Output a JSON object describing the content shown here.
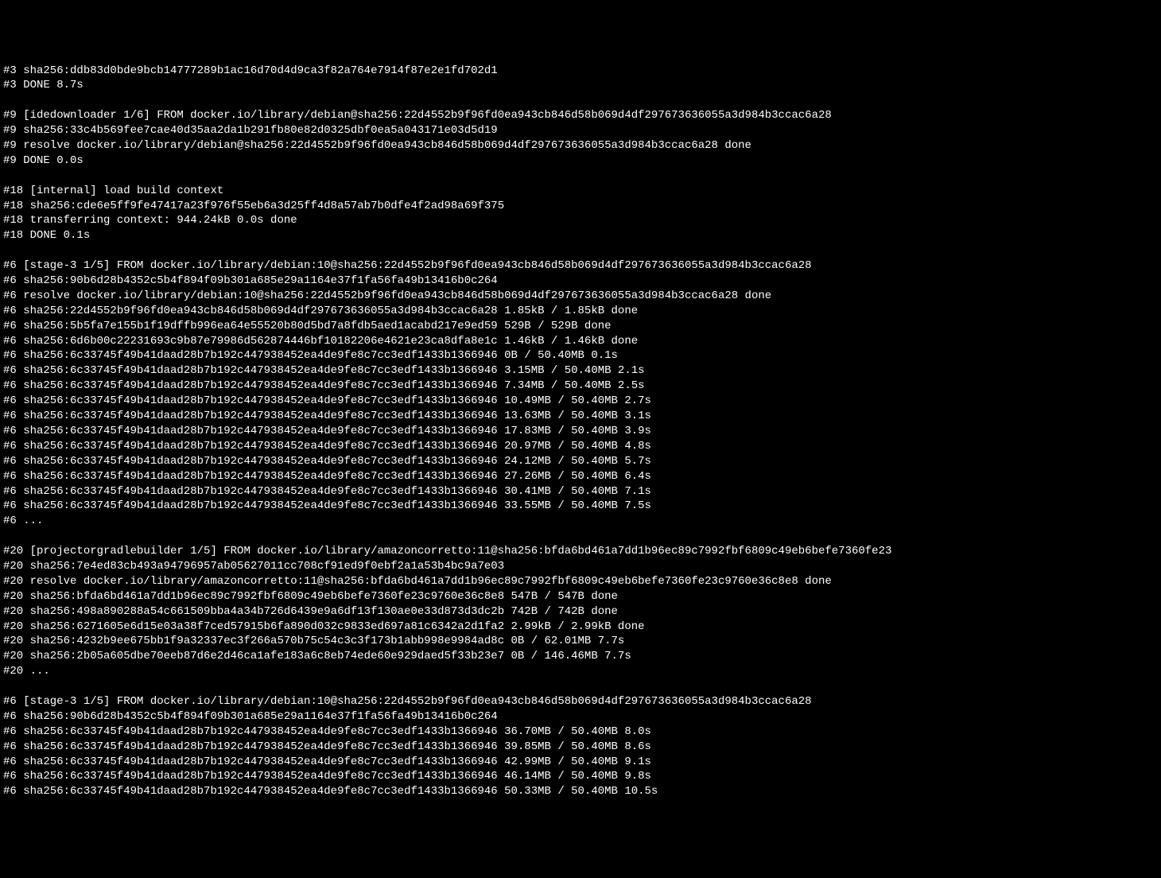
{
  "lines": [
    "#3 sha256:ddb83d0bde9bcb14777289b1ac16d70d4d9ca3f82a764e7914f87e2e1fd702d1",
    "#3 DONE 8.7s",
    "",
    "#9 [idedownloader 1/6] FROM docker.io/library/debian@sha256:22d4552b9f96fd0ea943cb846d58b069d4df297673636055a3d984b3ccac6a28",
    "#9 sha256:33c4b569fee7cae40d35aa2da1b291fb80e82d0325dbf0ea5a043171e03d5d19",
    "#9 resolve docker.io/library/debian@sha256:22d4552b9f96fd0ea943cb846d58b069d4df297673636055a3d984b3ccac6a28 done",
    "#9 DONE 0.0s",
    "",
    "#18 [internal] load build context",
    "#18 sha256:cde6e5ff9fe47417a23f976f55eb6a3d25ff4d8a57ab7b0dfe4f2ad98a69f375",
    "#18 transferring context: 944.24kB 0.0s done",
    "#18 DONE 0.1s",
    "",
    "#6 [stage-3 1/5] FROM docker.io/library/debian:10@sha256:22d4552b9f96fd0ea943cb846d58b069d4df297673636055a3d984b3ccac6a28",
    "#6 sha256:90b6d28b4352c5b4f894f09b301a685e29a1164e37f1fa56fa49b13416b0c264",
    "#6 resolve docker.io/library/debian:10@sha256:22d4552b9f96fd0ea943cb846d58b069d4df297673636055a3d984b3ccac6a28 done",
    "#6 sha256:22d4552b9f96fd0ea943cb846d58b069d4df297673636055a3d984b3ccac6a28 1.85kB / 1.85kB done",
    "#6 sha256:5b5fa7e155b1f19dffb996ea64e55520b80d5bd7a8fdb5aed1acabd217e9ed59 529B / 529B done",
    "#6 sha256:6d6b00c22231693c9b87e79986d562874446bf10182206e4621e23ca8dfa8e1c 1.46kB / 1.46kB done",
    "#6 sha256:6c33745f49b41daad28b7b192c447938452ea4de9fe8c7cc3edf1433b1366946 0B / 50.40MB 0.1s",
    "#6 sha256:6c33745f49b41daad28b7b192c447938452ea4de9fe8c7cc3edf1433b1366946 3.15MB / 50.40MB 2.1s",
    "#6 sha256:6c33745f49b41daad28b7b192c447938452ea4de9fe8c7cc3edf1433b1366946 7.34MB / 50.40MB 2.5s",
    "#6 sha256:6c33745f49b41daad28b7b192c447938452ea4de9fe8c7cc3edf1433b1366946 10.49MB / 50.40MB 2.7s",
    "#6 sha256:6c33745f49b41daad28b7b192c447938452ea4de9fe8c7cc3edf1433b1366946 13.63MB / 50.40MB 3.1s",
    "#6 sha256:6c33745f49b41daad28b7b192c447938452ea4de9fe8c7cc3edf1433b1366946 17.83MB / 50.40MB 3.9s",
    "#6 sha256:6c33745f49b41daad28b7b192c447938452ea4de9fe8c7cc3edf1433b1366946 20.97MB / 50.40MB 4.8s",
    "#6 sha256:6c33745f49b41daad28b7b192c447938452ea4de9fe8c7cc3edf1433b1366946 24.12MB / 50.40MB 5.7s",
    "#6 sha256:6c33745f49b41daad28b7b192c447938452ea4de9fe8c7cc3edf1433b1366946 27.26MB / 50.40MB 6.4s",
    "#6 sha256:6c33745f49b41daad28b7b192c447938452ea4de9fe8c7cc3edf1433b1366946 30.41MB / 50.40MB 7.1s",
    "#6 sha256:6c33745f49b41daad28b7b192c447938452ea4de9fe8c7cc3edf1433b1366946 33.55MB / 50.40MB 7.5s",
    "#6 ...",
    "",
    "#20 [projectorgradlebuilder 1/5] FROM docker.io/library/amazoncorretto:11@sha256:bfda6bd461a7dd1b96ec89c7992fbf6809c49eb6befe7360fe23",
    "#20 sha256:7e4ed83cb493a94796957ab05627011cc708cf91ed9f0ebf2a1a53b4bc9a7e03",
    "#20 resolve docker.io/library/amazoncorretto:11@sha256:bfda6bd461a7dd1b96ec89c7992fbf6809c49eb6befe7360fe23c9760e36c8e8 done",
    "#20 sha256:bfda6bd461a7dd1b96ec89c7992fbf6809c49eb6befe7360fe23c9760e36c8e8 547B / 547B done",
    "#20 sha256:498a890288a54c661509bba4a34b726d6439e9a6df13f130ae0e33d873d3dc2b 742B / 742B done",
    "#20 sha256:6271605e6d15e03a38f7ced57915b6fa890d032c9833ed697a81c6342a2d1fa2 2.99kB / 2.99kB done",
    "#20 sha256:4232b9ee675bb1f9a32337ec3f266a570b75c54c3c3f173b1abb998e9984ad8c 0B / 62.01MB 7.7s",
    "#20 sha256:2b05a605dbe70eeb87d6e2d46ca1afe183a6c8eb74ede60e929daed5f33b23e7 0B / 146.46MB 7.7s",
    "#20 ...",
    "",
    "#6 [stage-3 1/5] FROM docker.io/library/debian:10@sha256:22d4552b9f96fd0ea943cb846d58b069d4df297673636055a3d984b3ccac6a28",
    "#6 sha256:90b6d28b4352c5b4f894f09b301a685e29a1164e37f1fa56fa49b13416b0c264",
    "#6 sha256:6c33745f49b41daad28b7b192c447938452ea4de9fe8c7cc3edf1433b1366946 36.70MB / 50.40MB 8.0s",
    "#6 sha256:6c33745f49b41daad28b7b192c447938452ea4de9fe8c7cc3edf1433b1366946 39.85MB / 50.40MB 8.6s",
    "#6 sha256:6c33745f49b41daad28b7b192c447938452ea4de9fe8c7cc3edf1433b1366946 42.99MB / 50.40MB 9.1s",
    "#6 sha256:6c33745f49b41daad28b7b192c447938452ea4de9fe8c7cc3edf1433b1366946 46.14MB / 50.40MB 9.8s",
    "#6 sha256:6c33745f49b41daad28b7b192c447938452ea4de9fe8c7cc3edf1433b1366946 50.33MB / 50.40MB 10.5s"
  ]
}
